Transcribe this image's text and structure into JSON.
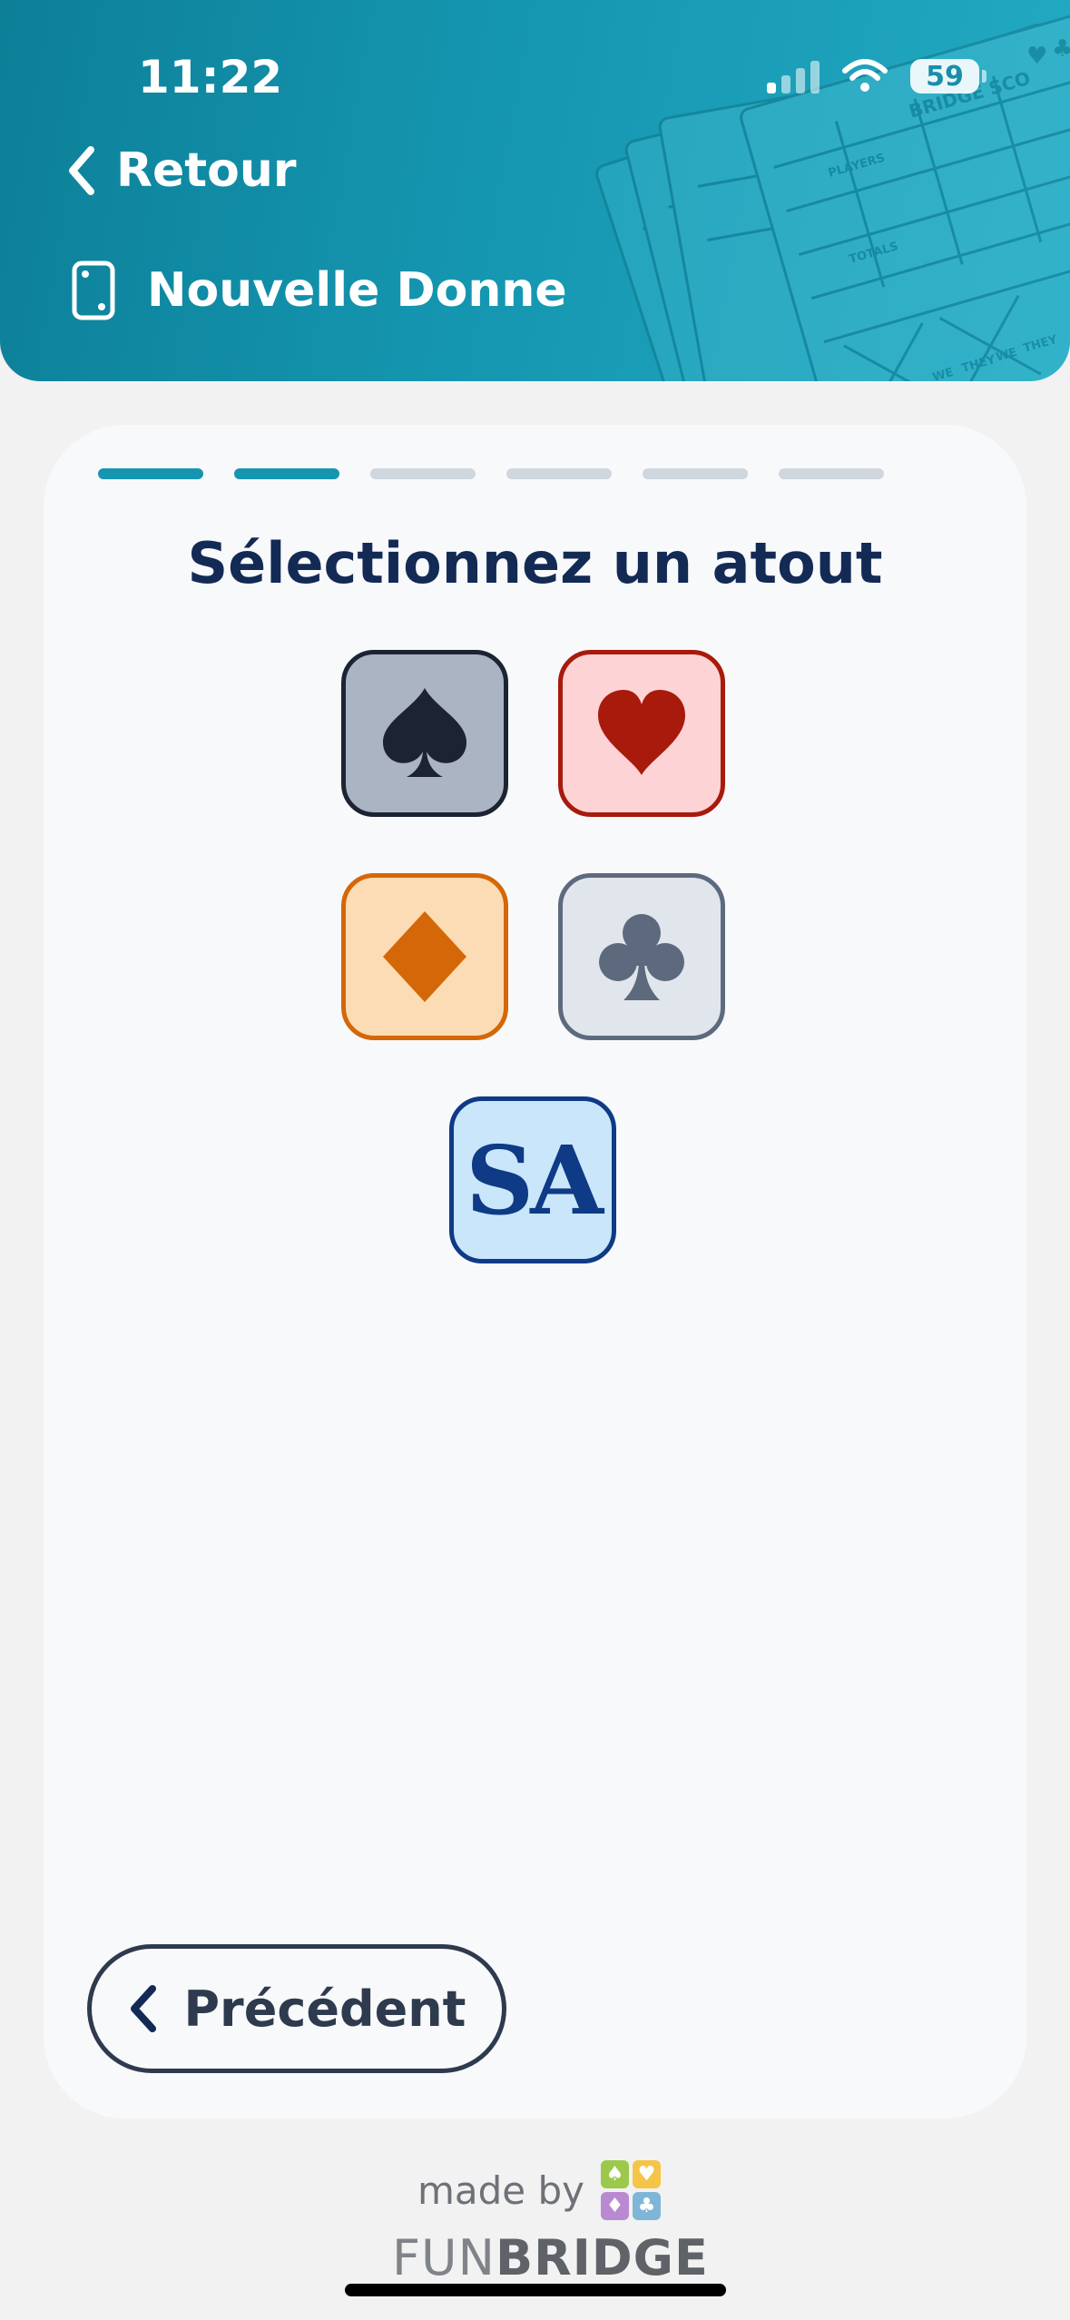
{
  "status_bar": {
    "time": "11:22",
    "battery": "59"
  },
  "header": {
    "back_label": "Retour",
    "title": "Nouvelle Donne",
    "background_text": [
      "BRIDGE SCO",
      "PLAYERS",
      "TOTALS",
      "WE",
      "THEY",
      "WE",
      "THEY"
    ]
  },
  "progress": {
    "steps": 6,
    "completed": 2,
    "active_color": "#1595b0",
    "inactive_color": "#d0d6de"
  },
  "main": {
    "heading": "Sélectionnez un atout",
    "options": [
      {
        "id": "spades",
        "icon": "spade-icon",
        "bg": "#aab4c3",
        "border": "#1c2433",
        "fg": "#1c2433"
      },
      {
        "id": "hearts",
        "icon": "heart-icon",
        "bg": "#fdd3d6",
        "border": "#a81a0c",
        "fg": "#a81a0c"
      },
      {
        "id": "diamonds",
        "icon": "diamond-icon",
        "bg": "#fcdcb4",
        "border": "#d46708",
        "fg": "#d46708"
      },
      {
        "id": "clubs",
        "icon": "club-icon",
        "bg": "#e1e6ed",
        "border": "#5d6a7e",
        "fg": "#5d6a7e"
      },
      {
        "id": "no-trump",
        "label": "SA",
        "bg": "#c9e6fb",
        "border": "#0e3a86",
        "fg": "#0e3a86"
      }
    ]
  },
  "nav": {
    "previous_label": "Précédent"
  },
  "footer": {
    "made_by": "made by",
    "brand_fun": "FUN",
    "brand_bridge": "BRIDGE"
  }
}
